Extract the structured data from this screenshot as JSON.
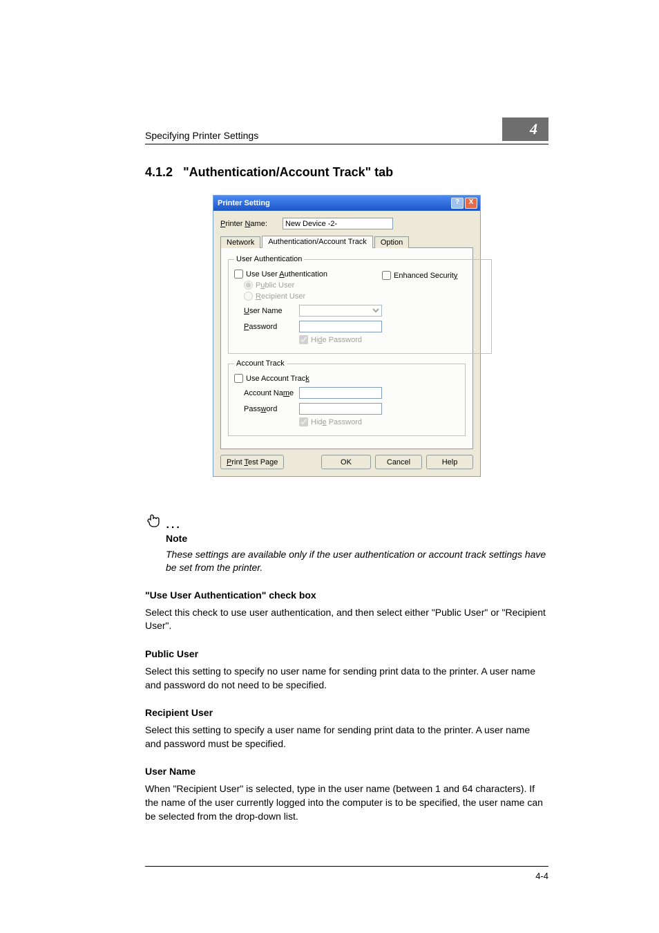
{
  "header": {
    "breadcrumb": "Specifying Printer Settings",
    "chapter": "4"
  },
  "section": {
    "number": "4.1.2",
    "title": "\"Authentication/Account Track\" tab"
  },
  "dialog": {
    "title": "Printer Setting",
    "help_btn": "?",
    "close_btn": "X",
    "printer_name_label": "Printer Name:",
    "printer_name_value": "New Device -2-",
    "tabs": {
      "network": "Network",
      "auth": "Authentication/Account Track",
      "option": "Option"
    },
    "user_auth": {
      "legend": "User Authentication",
      "use_user_auth": "Use User Authentication",
      "enhanced_security": "Enhanced Security",
      "public_user": "Public User",
      "recipient_user": "Recipient User",
      "user_name_label": "User Name",
      "password_label": "Password",
      "hide_password": "Hide Password"
    },
    "account_track": {
      "legend": "Account Track",
      "use_account_track": "Use Account Track",
      "account_name_label": "Account Name",
      "password_label": "Password",
      "hide_password": "Hide Password"
    },
    "buttons": {
      "print_test": "Print Test Page",
      "ok": "OK",
      "cancel": "Cancel",
      "help": "Help"
    }
  },
  "note": {
    "label": "Note",
    "text": "These settings are available only if the user authentication or account track settings have be set from the printer."
  },
  "sections": {
    "use_user_auth": {
      "heading": "\"Use User Authentication\" check box",
      "body": "Select this check to use user authentication, and then select either \"Public User\" or \"Recipient User\"."
    },
    "public_user": {
      "heading": "Public User",
      "body": "Select this setting to specify no user name for sending print data to the printer. A user name and password do not need to be specified."
    },
    "recipient_user": {
      "heading": "Recipient User",
      "body": "Select this setting to specify a user name for sending print data to the printer. A user name and password must be specified."
    },
    "user_name": {
      "heading": "User Name",
      "body": "When \"Recipient User\" is selected, type in the user name (between 1 and 64 characters). If the name of the user currently logged into the computer is to be specified, the user name can be selected from the drop-down list."
    }
  },
  "footer": {
    "page": "4-4"
  }
}
